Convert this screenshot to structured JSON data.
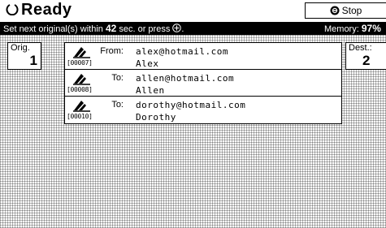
{
  "header": {
    "status_title": "Ready",
    "stop_label": "Stop"
  },
  "infobar": {
    "message_prefix": "Set next original(s) within ",
    "seconds": "42",
    "message_suffix": " sec. or press ",
    "memory_label": "Memory:",
    "memory_value": "97%"
  },
  "originals": {
    "label": "Orig.",
    "count": "1"
  },
  "destinations": {
    "label": "Dest.:",
    "count": "2"
  },
  "entries": [
    {
      "direction": "From:",
      "code": "[00007]",
      "address": "alex@hotmail.com",
      "name": "Alex",
      "icon": "email-icon"
    },
    {
      "direction": "To:",
      "code": "[00008]",
      "address": "allen@hotmail.com",
      "name": "Allen",
      "icon": "email-icon"
    },
    {
      "direction": "To:",
      "code": "[00010]",
      "address": "dorothy@hotmail.com",
      "name": "Dorothy",
      "icon": "email-icon"
    }
  ]
}
